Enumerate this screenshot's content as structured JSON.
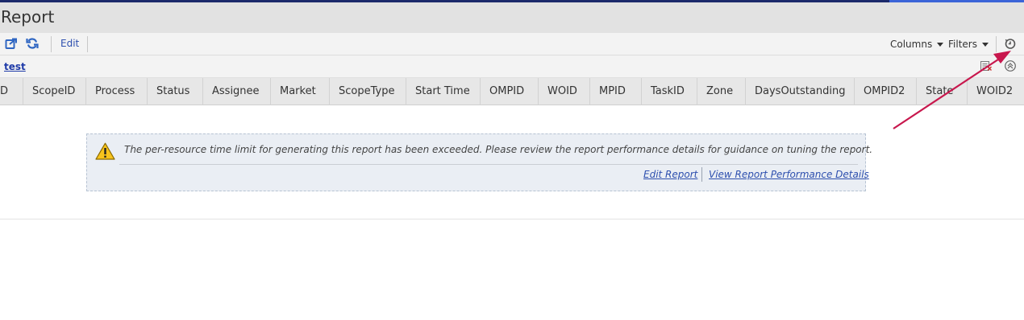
{
  "window": {
    "title": "Report"
  },
  "toolbar": {
    "export_icon": "export-icon",
    "refresh_icon": "refresh-icon",
    "edit_label": "Edit",
    "columns_label": "Columns",
    "filters_label": "Filters",
    "history_icon": "clock-history-icon"
  },
  "group": {
    "label": "test",
    "icons": [
      "export-to-excel-icon",
      "collapse-up-icon"
    ]
  },
  "table": {
    "columns": [
      "D",
      "ScopeID",
      "Process",
      "Status",
      "Assignee",
      "Market",
      "ScopeType",
      "Start Time",
      "OMPID",
      "WOID",
      "MPID",
      "TaskID",
      "Zone",
      "DaysOutstanding",
      "OMPID2",
      "State",
      "WOID2"
    ]
  },
  "notice": {
    "icon": "warning-icon",
    "message": "The per-resource time limit for generating this report has been exceeded. Please review the report performance details for guidance on tuning the report.",
    "edit_link": "Edit Report",
    "details_link": "View Report Performance Details"
  },
  "colors": {
    "accent_link": "#2d4fae",
    "annotation_arrow": "#c8174d",
    "warning_yellow": "#f7c31c"
  }
}
